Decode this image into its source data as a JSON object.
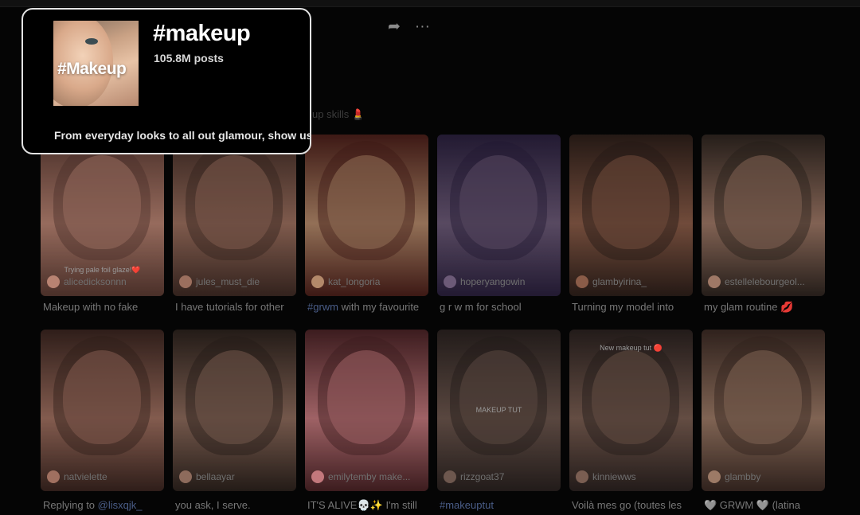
{
  "header": {
    "share_icon": "share-arrow-icon",
    "more_icon": "more-dots-icon",
    "description_behind": "up skills 💄"
  },
  "popup": {
    "cover_text": "#Makeup",
    "title": "#makeup",
    "post_count": "105.8M posts",
    "description": "From everyday looks to all out glamour, show us"
  },
  "videos": [
    {
      "author": "alicedicksonnn",
      "caption_tag": "",
      "caption": "Makeup with no fake",
      "overlay": "Trying pale foil glaze!❤️",
      "colors": [
        "#5a3a32",
        "#b88372"
      ]
    },
    {
      "author": "jules_must_die",
      "caption_tag": "",
      "caption": "I have tutorials for other",
      "overlay": "",
      "colors": [
        "#3e2a24",
        "#9b6f5e"
      ]
    },
    {
      "author": "kat_longoria",
      "caption_tag": "#grwm",
      "caption": " with my favourite",
      "overlay": "",
      "colors": [
        "#4b1f1a",
        "#b3896a"
      ]
    },
    {
      "author": "hoperyangowin",
      "caption_tag": "",
      "caption": "g r w m for school",
      "overlay": "",
      "colors": [
        "#2a203d",
        "#6c5a77"
      ]
    },
    {
      "author": "glambyirina_",
      "caption_tag": "",
      "caption": "Turning my model into",
      "overlay": "",
      "colors": [
        "#2d1f1a",
        "#8a5c48"
      ]
    },
    {
      "author": "estellelebourgeol...",
      "caption_tag": "",
      "caption": "my glam routine 💋",
      "overlay": "",
      "colors": [
        "#2e2520",
        "#9e7866"
      ]
    },
    {
      "author": "natvielette",
      "caption_tag": "",
      "caption": "Replying to ",
      "caption_end": "@lisxqjk_",
      "overlay": "",
      "colors": [
        "#3a2520",
        "#a07060"
      ]
    },
    {
      "author": "bellaayar",
      "caption_tag": "",
      "caption": "you ask, I serve.",
      "overlay": "",
      "colors": [
        "#2c221d",
        "#8d6b5c"
      ]
    },
    {
      "author": "emilytemby make...",
      "caption_tag": "",
      "caption": "IT'S ALIVE💀✨ I'm still",
      "overlay": "",
      "colors": [
        "#4a2326",
        "#c2787c"
      ]
    },
    {
      "author": "rizzgoat37",
      "caption_tag": "#makeuptut",
      "caption": "",
      "overlay": "MAKEUP TUT",
      "colors": [
        "#2a2220",
        "#6d574e"
      ]
    },
    {
      "author": "kinniewws",
      "caption_tag": "",
      "caption": "Voilà mes go (toutes les",
      "overlay": "New makeup tut 🔴",
      "colors": [
        "#2b2220",
        "#7a5e52"
      ]
    },
    {
      "author": "glambby",
      "caption_tag": "",
      "caption": "🩶 GRWM 🩶 (latina",
      "overlay": "",
      "colors": [
        "#3b2a24",
        "#9c7a66"
      ]
    }
  ]
}
